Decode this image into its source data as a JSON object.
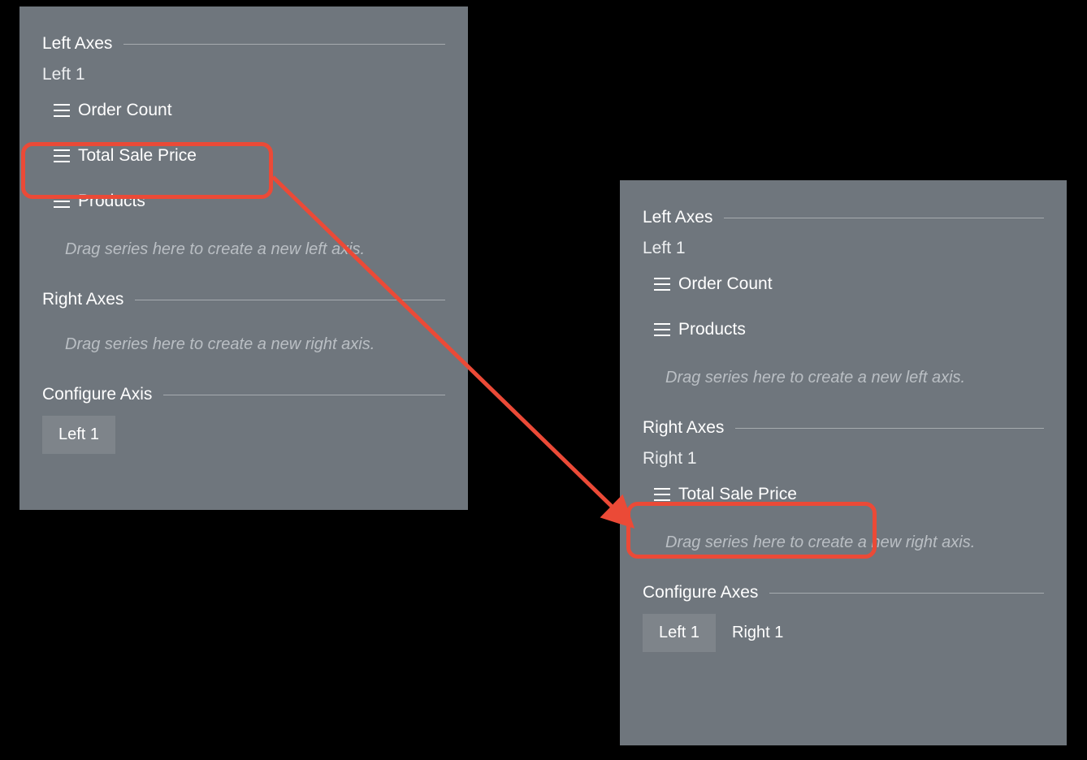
{
  "left_panel": {
    "left_axes_header": "Left Axes",
    "left_axis_1_label": "Left 1",
    "left_axis_1_series": [
      "Order Count",
      "Total Sale Price",
      "Products"
    ],
    "left_placeholder": "Drag series here to create a new left axis.",
    "right_axes_header": "Right Axes",
    "right_placeholder": "Drag series here to create a new right axis.",
    "configure_header": "Configure Axis",
    "tabs": [
      "Left 1"
    ]
  },
  "right_panel": {
    "left_axes_header": "Left Axes",
    "left_axis_1_label": "Left 1",
    "left_axis_1_series": [
      "Order Count",
      "Products"
    ],
    "left_placeholder": "Drag series here to create a new left axis.",
    "right_axes_header": "Right Axes",
    "right_axis_1_label": "Right 1",
    "right_axis_1_series": [
      "Total Sale Price"
    ],
    "right_placeholder": "Drag series here to create a new right axis.",
    "configure_header": "Configure Axes",
    "tabs": [
      "Left 1",
      "Right 1"
    ]
  },
  "annotation": {
    "highlight_color": "#eb4a37",
    "arrow_from_item": "Total Sale Price",
    "arrow_to_item": "Total Sale Price"
  }
}
